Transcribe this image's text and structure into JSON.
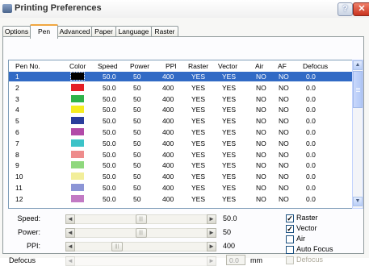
{
  "window": {
    "title": "Printing Preferences",
    "help_glyph": "?",
    "close_glyph": "✕"
  },
  "tabs": [
    {
      "label": "Options"
    },
    {
      "label": "Pen",
      "active": true
    },
    {
      "label": "Advanced"
    },
    {
      "label": "Paper"
    },
    {
      "label": "Language"
    },
    {
      "label": "Raster"
    }
  ],
  "table": {
    "headers": [
      "Pen No.",
      "Color",
      "Speed",
      "Power",
      "PPI",
      "Raster",
      "Vector",
      "Air",
      "AF",
      "Defocus"
    ],
    "rows": [
      {
        "pen": "1",
        "color": "#000000",
        "speed": "50.0",
        "power": "50",
        "ppi": "400",
        "raster": "YES",
        "vector": "YES",
        "air": "NO",
        "af": "NO",
        "defocus": "0.0",
        "selected": true
      },
      {
        "pen": "2",
        "color": "#e41f26",
        "speed": "50.0",
        "power": "50",
        "ppi": "400",
        "raster": "YES",
        "vector": "YES",
        "air": "NO",
        "af": "NO",
        "defocus": "0.0"
      },
      {
        "pen": "3",
        "color": "#2fb34a",
        "speed": "50.0",
        "power": "50",
        "ppi": "400",
        "raster": "YES",
        "vector": "YES",
        "air": "NO",
        "af": "NO",
        "defocus": "0.0"
      },
      {
        "pen": "4",
        "color": "#f5ec1f",
        "speed": "50.0",
        "power": "50",
        "ppi": "400",
        "raster": "YES",
        "vector": "YES",
        "air": "NO",
        "af": "NO",
        "defocus": "0.0"
      },
      {
        "pen": "5",
        "color": "#2a3d9c",
        "speed": "50.0",
        "power": "50",
        "ppi": "400",
        "raster": "YES",
        "vector": "YES",
        "air": "NO",
        "af": "NO",
        "defocus": "0.0"
      },
      {
        "pen": "6",
        "color": "#b24aa8",
        "speed": "50.0",
        "power": "50",
        "ppi": "400",
        "raster": "YES",
        "vector": "YES",
        "air": "NO",
        "af": "NO",
        "defocus": "0.0"
      },
      {
        "pen": "7",
        "color": "#3cc3c8",
        "speed": "50.0",
        "power": "50",
        "ppi": "400",
        "raster": "YES",
        "vector": "YES",
        "air": "NO",
        "af": "NO",
        "defocus": "0.0"
      },
      {
        "pen": "8",
        "color": "#ee8c8c",
        "speed": "50.0",
        "power": "50",
        "ppi": "400",
        "raster": "YES",
        "vector": "YES",
        "air": "NO",
        "af": "NO",
        "defocus": "0.0"
      },
      {
        "pen": "9",
        "color": "#8fd87d",
        "speed": "50.0",
        "power": "50",
        "ppi": "400",
        "raster": "YES",
        "vector": "YES",
        "air": "NO",
        "af": "NO",
        "defocus": "0.0"
      },
      {
        "pen": "10",
        "color": "#f2ee9a",
        "speed": "50.0",
        "power": "50",
        "ppi": "400",
        "raster": "YES",
        "vector": "YES",
        "air": "NO",
        "af": "NO",
        "defocus": "0.0"
      },
      {
        "pen": "11",
        "color": "#8c95d6",
        "speed": "50.0",
        "power": "50",
        "ppi": "400",
        "raster": "YES",
        "vector": "YES",
        "air": "NO",
        "af": "NO",
        "defocus": "0.0"
      },
      {
        "pen": "12",
        "color": "#c27ac4",
        "speed": "50.0",
        "power": "50",
        "ppi": "400",
        "raster": "YES",
        "vector": "YES",
        "air": "NO",
        "af": "NO",
        "defocus": "0.0"
      }
    ]
  },
  "scroll_glyphs": {
    "up": "▲",
    "down": "▼",
    "left": "◄",
    "right": "►",
    "grip": "|||"
  },
  "controls": {
    "speed": {
      "label": "Speed:",
      "value": "50.0",
      "level": 0.5
    },
    "power": {
      "label": "Power:",
      "value": "50",
      "level": 0.5
    },
    "ppi": {
      "label": "PPI:",
      "value": "400",
      "level": 0.3
    },
    "defocus": {
      "label": "Defocus",
      "value": "0.0",
      "unit": "mm",
      "disabled": true
    }
  },
  "checkboxes": [
    {
      "label": "Raster",
      "checked": true
    },
    {
      "label": "Vector",
      "checked": true
    },
    {
      "label": "Air",
      "checked": false
    },
    {
      "label": "Auto Focus",
      "checked": false
    },
    {
      "label": "Defocus",
      "checked": false,
      "disabled": true
    }
  ],
  "check_glyph": "✓"
}
